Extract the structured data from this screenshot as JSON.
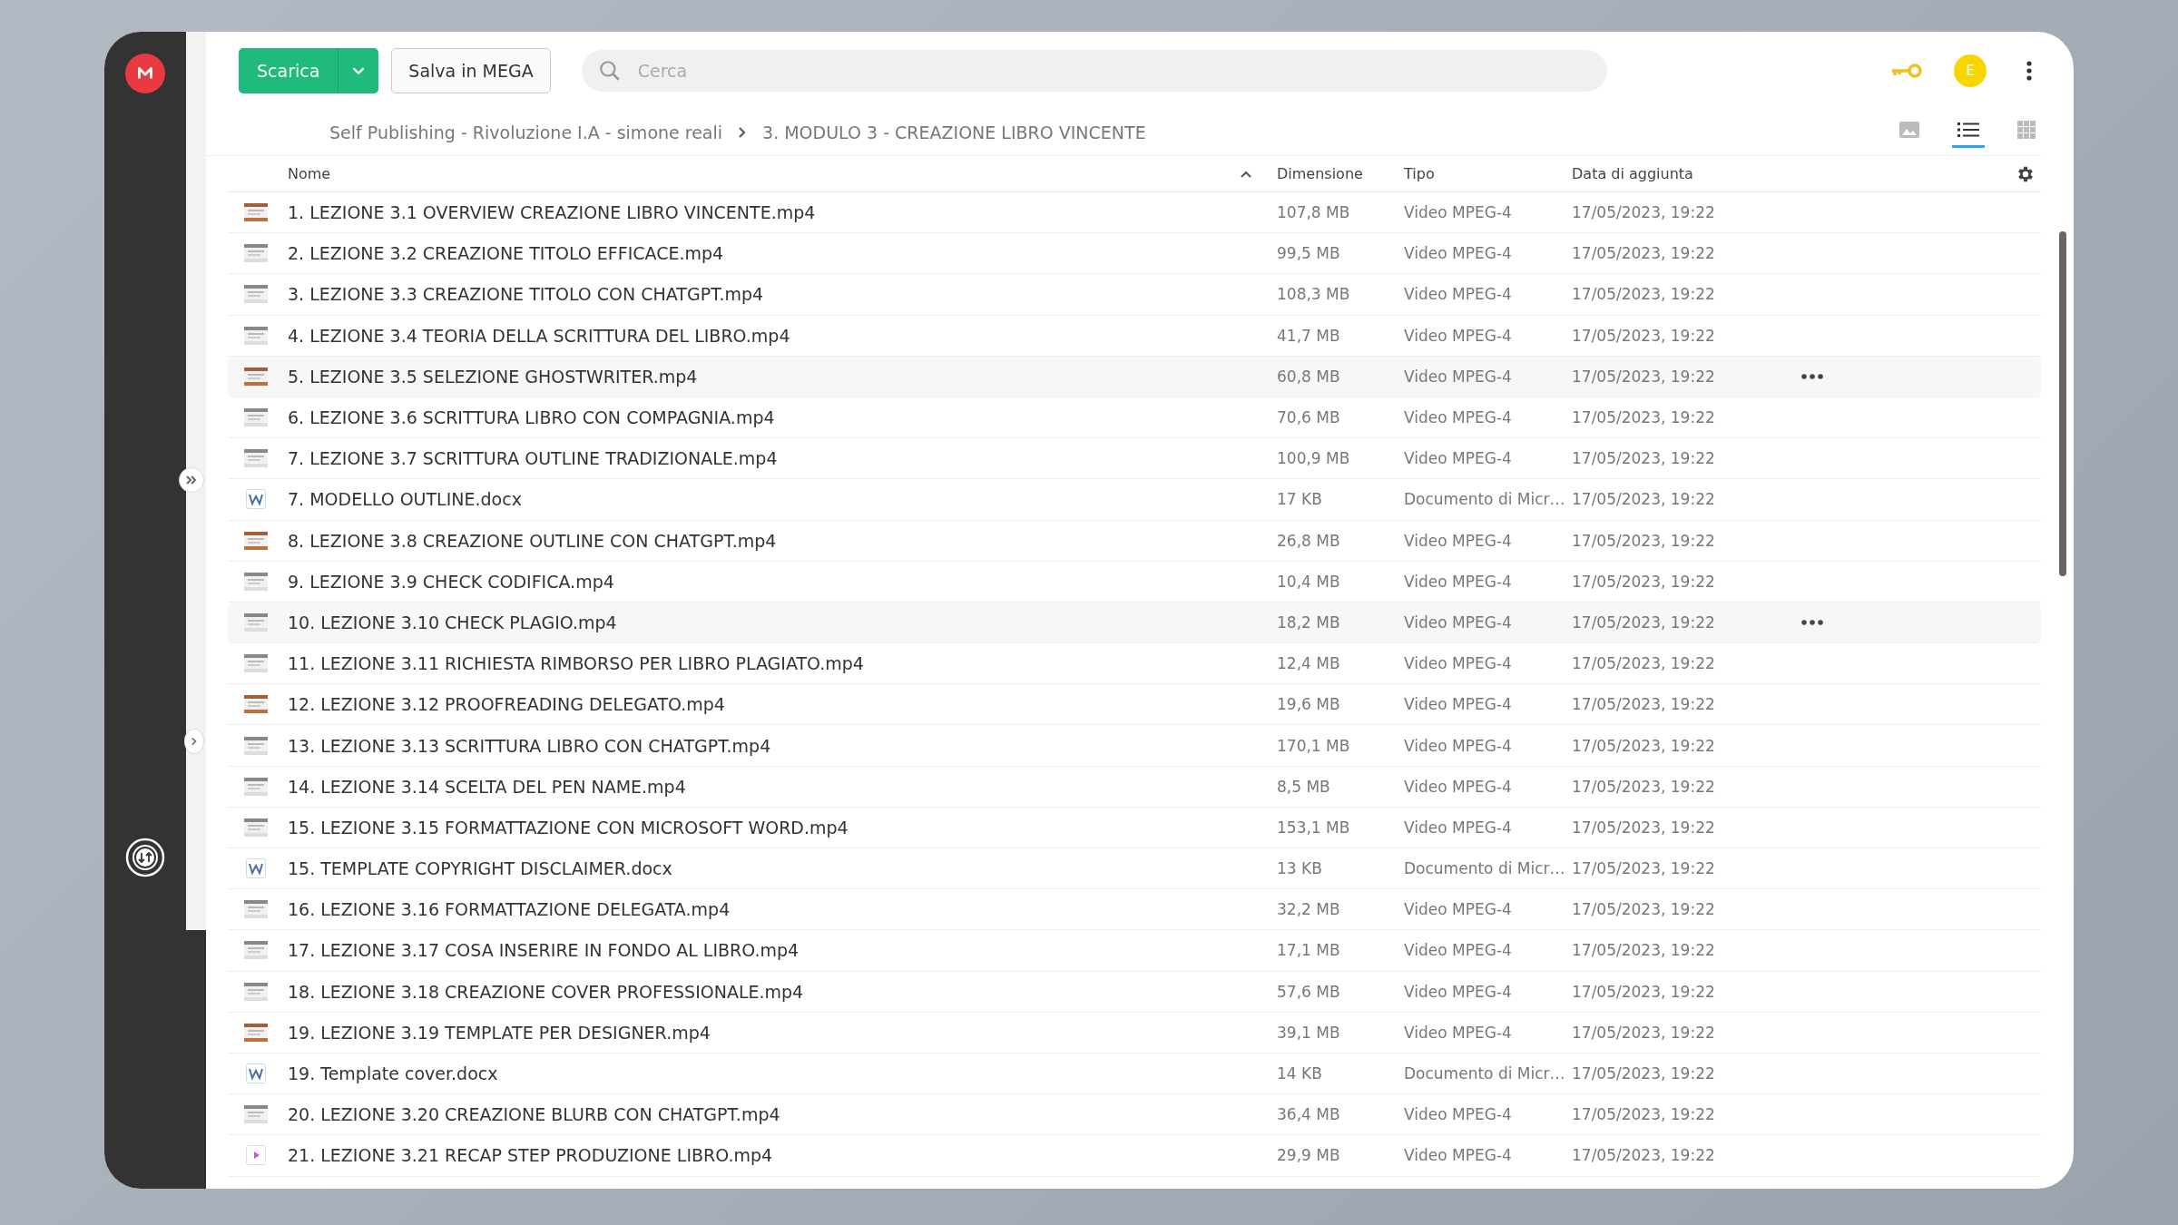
{
  "toolbar": {
    "download_button": "Scarica",
    "save_button": "Salva in MEGA",
    "search": {
      "placeholder": "Cerca"
    },
    "avatar": "E"
  },
  "breadcrumb": [
    "Self Publishing - Rivoluzione I.A - simone reali",
    "3. MODULO 3 - CREAZIONE LIBRO VINCENTE"
  ],
  "view_modes": [
    {
      "kind": "thumbnails",
      "selected": false
    },
    {
      "kind": "list",
      "selected": true
    },
    {
      "kind": "grid",
      "selected": false
    }
  ],
  "table": {
    "columns": [
      "Nome",
      "Dimensione",
      "Tipo",
      "Data di aggiunta"
    ],
    "rows": [
      {
        "kind": "thumb",
        "name": "1. LEZIONE 3.1 OVERVIEW CREAZIONE LIBRO VINCENTE.mp4",
        "size": "107,8 MB",
        "type": "Video MPEG-4",
        "date": "17/05/2023, 19:22",
        "highlighted": false
      },
      {
        "kind": "thumb",
        "name": "2. LEZIONE 3.2 CREAZIONE TITOLO EFFICACE.mp4",
        "size": "99,5 MB",
        "type": "Video MPEG-4",
        "date": "17/05/2023, 19:22",
        "highlighted": false
      },
      {
        "kind": "thumb",
        "name": "3. LEZIONE 3.3 CREAZIONE TITOLO CON CHATGPT.mp4",
        "size": "108,3 MB",
        "type": "Video MPEG-4",
        "date": "17/05/2023, 19:22",
        "highlighted": false
      },
      {
        "kind": "thumb",
        "name": "4. LEZIONE 3.4 TEORIA DELLA SCRITTURA DEL LIBRO.mp4",
        "size": "41,7 MB",
        "type": "Video MPEG-4",
        "date": "17/05/2023, 19:22",
        "highlighted": false
      },
      {
        "kind": "thumb",
        "name": "5. LEZIONE 3.5 SELEZIONE GHOSTWRITER.mp4",
        "size": "60,8 MB",
        "type": "Video MPEG-4",
        "date": "17/05/2023, 19:22",
        "highlighted": true
      },
      {
        "kind": "thumb",
        "name": "6. LEZIONE 3.6 SCRITTURA LIBRO CON COMPAGNIA.mp4",
        "size": "70,6 MB",
        "type": "Video MPEG-4",
        "date": "17/05/2023, 19:22",
        "highlighted": false
      },
      {
        "kind": "thumb",
        "name": "7. LEZIONE 3.7 SCRITTURA OUTLINE TRADIZIONALE.mp4",
        "size": "100,9 MB",
        "type": "Video MPEG-4",
        "date": "17/05/2023, 19:22",
        "highlighted": false
      },
      {
        "kind": "word",
        "name": "7. MODELLO OUTLINE.docx",
        "size": "17 KB",
        "type": "Documento di Micr…",
        "date": "17/05/2023, 19:22",
        "highlighted": false
      },
      {
        "kind": "thumb",
        "name": "8. LEZIONE 3.8 CREAZIONE OUTLINE CON CHATGPT.mp4",
        "size": "26,8 MB",
        "type": "Video MPEG-4",
        "date": "17/05/2023, 19:22",
        "highlighted": false
      },
      {
        "kind": "thumb",
        "name": "9. LEZIONE 3.9 CHECK CODIFICA.mp4",
        "size": "10,4 MB",
        "type": "Video MPEG-4",
        "date": "17/05/2023, 19:22",
        "highlighted": false
      },
      {
        "kind": "thumb",
        "name": "10. LEZIONE 3.10 CHECK PLAGIO.mp4",
        "size": "18,2 MB",
        "type": "Video MPEG-4",
        "date": "17/05/2023, 19:22",
        "highlighted": true
      },
      {
        "kind": "thumb",
        "name": "11. LEZIONE 3.11 RICHIESTA RIMBORSO PER LIBRO PLAGIATO.mp4",
        "size": "12,4 MB",
        "type": "Video MPEG-4",
        "date": "17/05/2023, 19:22",
        "highlighted": false
      },
      {
        "kind": "thumb",
        "name": "12. LEZIONE 3.12 PROOFREADING DELEGATO.mp4",
        "size": "19,6 MB",
        "type": "Video MPEG-4",
        "date": "17/05/2023, 19:22",
        "highlighted": false
      },
      {
        "kind": "thumb",
        "name": "13. LEZIONE 3.13 SCRITTURA LIBRO CON CHATGPT.mp4",
        "size": "170,1 MB",
        "type": "Video MPEG-4",
        "date": "17/05/2023, 19:22",
        "highlighted": false
      },
      {
        "kind": "thumb",
        "name": "14. LEZIONE 3.14 SCELTA DEL PEN NAME.mp4",
        "size": "8,5 MB",
        "type": "Video MPEG-4",
        "date": "17/05/2023, 19:22",
        "highlighted": false
      },
      {
        "kind": "thumb",
        "name": "15. LEZIONE 3.15 FORMATTAZIONE CON MICROSOFT WORD.mp4",
        "size": "153,1 MB",
        "type": "Video MPEG-4",
        "date": "17/05/2023, 19:22",
        "highlighted": false
      },
      {
        "kind": "word",
        "name": "15. TEMPLATE COPYRIGHT DISCLAIMER.docx",
        "size": "13 KB",
        "type": "Documento di Micr…",
        "date": "17/05/2023, 19:22",
        "highlighted": false
      },
      {
        "kind": "thumb",
        "name": "16. LEZIONE 3.16 FORMATTAZIONE DELEGATA.mp4",
        "size": "32,2 MB",
        "type": "Video MPEG-4",
        "date": "17/05/2023, 19:22",
        "highlighted": false
      },
      {
        "kind": "thumb",
        "name": "17. LEZIONE 3.17 COSA INSERIRE IN FONDO AL LIBRO.mp4",
        "size": "17,1 MB",
        "type": "Video MPEG-4",
        "date": "17/05/2023, 19:22",
        "highlighted": false
      },
      {
        "kind": "thumb",
        "name": "18. LEZIONE 3.18 CREAZIONE COVER PROFESSIONALE.mp4",
        "size": "57,6 MB",
        "type": "Video MPEG-4",
        "date": "17/05/2023, 19:22",
        "highlighted": false
      },
      {
        "kind": "thumb",
        "name": "19. LEZIONE 3.19 TEMPLATE PER DESIGNER.mp4",
        "size": "39,1 MB",
        "type": "Video MPEG-4",
        "date": "17/05/2023, 19:22",
        "highlighted": false
      },
      {
        "kind": "word",
        "name": "19. Template cover.docx",
        "size": "14 KB",
        "type": "Documento di Micr…",
        "date": "17/05/2023, 19:22",
        "highlighted": false
      },
      {
        "kind": "thumb",
        "name": "20. LEZIONE 3.20 CREAZIONE BLURB CON CHATGPT.mp4",
        "size": "36,4 MB",
        "type": "Video MPEG-4",
        "date": "17/05/2023, 19:22",
        "highlighted": false
      },
      {
        "kind": "video",
        "name": "21. LEZIONE 3.21 RECAP STEP PRODUZIONE LIBRO.mp4",
        "size": "29,9 MB",
        "type": "Video MPEG-4",
        "date": "17/05/2023, 19:22",
        "highlighted": false
      }
    ]
  }
}
